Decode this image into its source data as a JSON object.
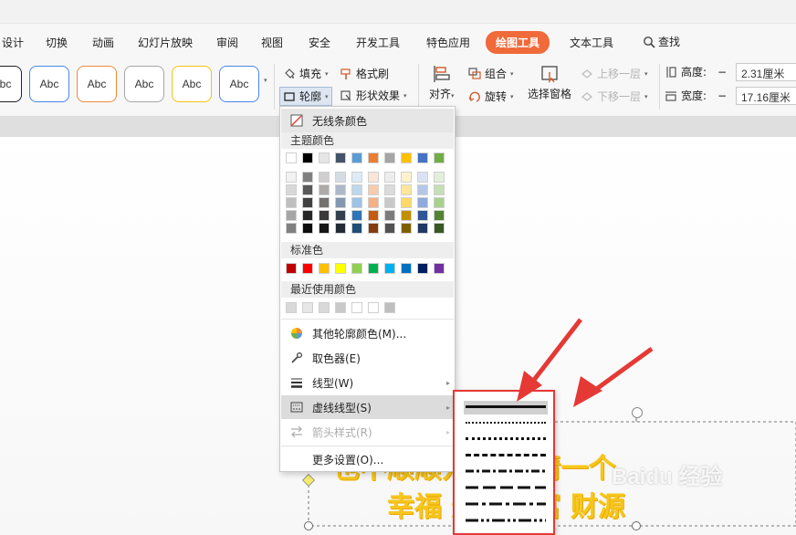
{
  "menu_tabs": [
    "设计",
    "切换",
    "动画",
    "幻灯片放映",
    "审阅",
    "视图",
    "安全",
    "开发工具",
    "特色应用",
    "绘图工具",
    "文本工具"
  ],
  "search_label": "查找",
  "style_gallery": [
    "Abc",
    "Abc",
    "Abc",
    "Abc",
    "Abc",
    "Abc"
  ],
  "style_colors": [
    "#222222",
    "#4a86e8",
    "#f08a3a",
    "#a6a6a6",
    "#f4c20d",
    "#4a86e8"
  ],
  "ribbon": {
    "fill": "填充",
    "format_painter": "格式刷",
    "outline": "轮廓",
    "shape_effect": "形状效果",
    "align": "对齐",
    "group": "组合",
    "rotate": "旋转",
    "selection_pane": "选择窗格",
    "bring_forward": "上移一层",
    "send_backward": "下移一层",
    "height_label": "高度:",
    "width_label": "宽度:",
    "height_value": "2.31厘米",
    "width_value": "17.16厘米"
  },
  "dropdown": {
    "no_line": "无线条颜色",
    "theme_colors_label": "主题颜色",
    "standard_colors_label": "标准色",
    "recent_colors_label": "最近使用颜色",
    "more_colors": "其他轮廓颜色(M)...",
    "eyedropper": "取色器(E)",
    "line_type": "线型(W)",
    "dash_type": "虚线线型(S)",
    "arrow_style": "箭头样式(R)",
    "more_settings": "更多设置(O)..."
  },
  "theme_colors": [
    "#ffffff",
    "#000000",
    "#e7e6e6",
    "#44546a",
    "#5b9bd5",
    "#ed7d31",
    "#a5a5a5",
    "#ffc000",
    "#4472c4",
    "#70ad47"
  ],
  "theme_shades": [
    [
      "#f2f2f2",
      "#d9d9d9",
      "#bfbfbf",
      "#a6a6a6",
      "#808080"
    ],
    [
      "#808080",
      "#595959",
      "#404040",
      "#262626",
      "#0d0d0d"
    ],
    [
      "#d0cece",
      "#aeaaaa",
      "#757171",
      "#3a3838",
      "#171616"
    ],
    [
      "#d6dce4",
      "#adb9ca",
      "#8497b0",
      "#333f4f",
      "#222a35"
    ],
    [
      "#deebf7",
      "#bdd7ee",
      "#9dc3e6",
      "#2e75b6",
      "#1f4e79"
    ],
    [
      "#fbe5d6",
      "#f8cbad",
      "#f4b183",
      "#c55a11",
      "#843c0c"
    ],
    [
      "#ededed",
      "#dbdbdb",
      "#c9c9c9",
      "#7b7b7b",
      "#525252"
    ],
    [
      "#fff2cc",
      "#ffe699",
      "#ffd966",
      "#bf9000",
      "#7f6000"
    ],
    [
      "#dae3f3",
      "#b4c7e7",
      "#8faadc",
      "#2f5597",
      "#203864"
    ],
    [
      "#e2f0d9",
      "#c5e0b4",
      "#a9d18e",
      "#548235",
      "#385723"
    ]
  ],
  "standard_colors": [
    "#c00000",
    "#ff0000",
    "#ffc000",
    "#ffff00",
    "#92d050",
    "#00b050",
    "#00b0f0",
    "#0070c0",
    "#002060",
    "#7030a0"
  ],
  "recent_colors": [
    "#d9d9d9",
    "#e7e6e6",
    "#d9d9d9",
    "#c9c9c9",
    "#ffffff",
    "#ffffff",
    "#bfbfbf"
  ],
  "slide_text_line1": "也不顺顺开心 心情一个",
  "slide_text_line2": "幸福 爆炒财富 财源",
  "watermark": "Baidu 经验",
  "annotation_color": "#e53935"
}
